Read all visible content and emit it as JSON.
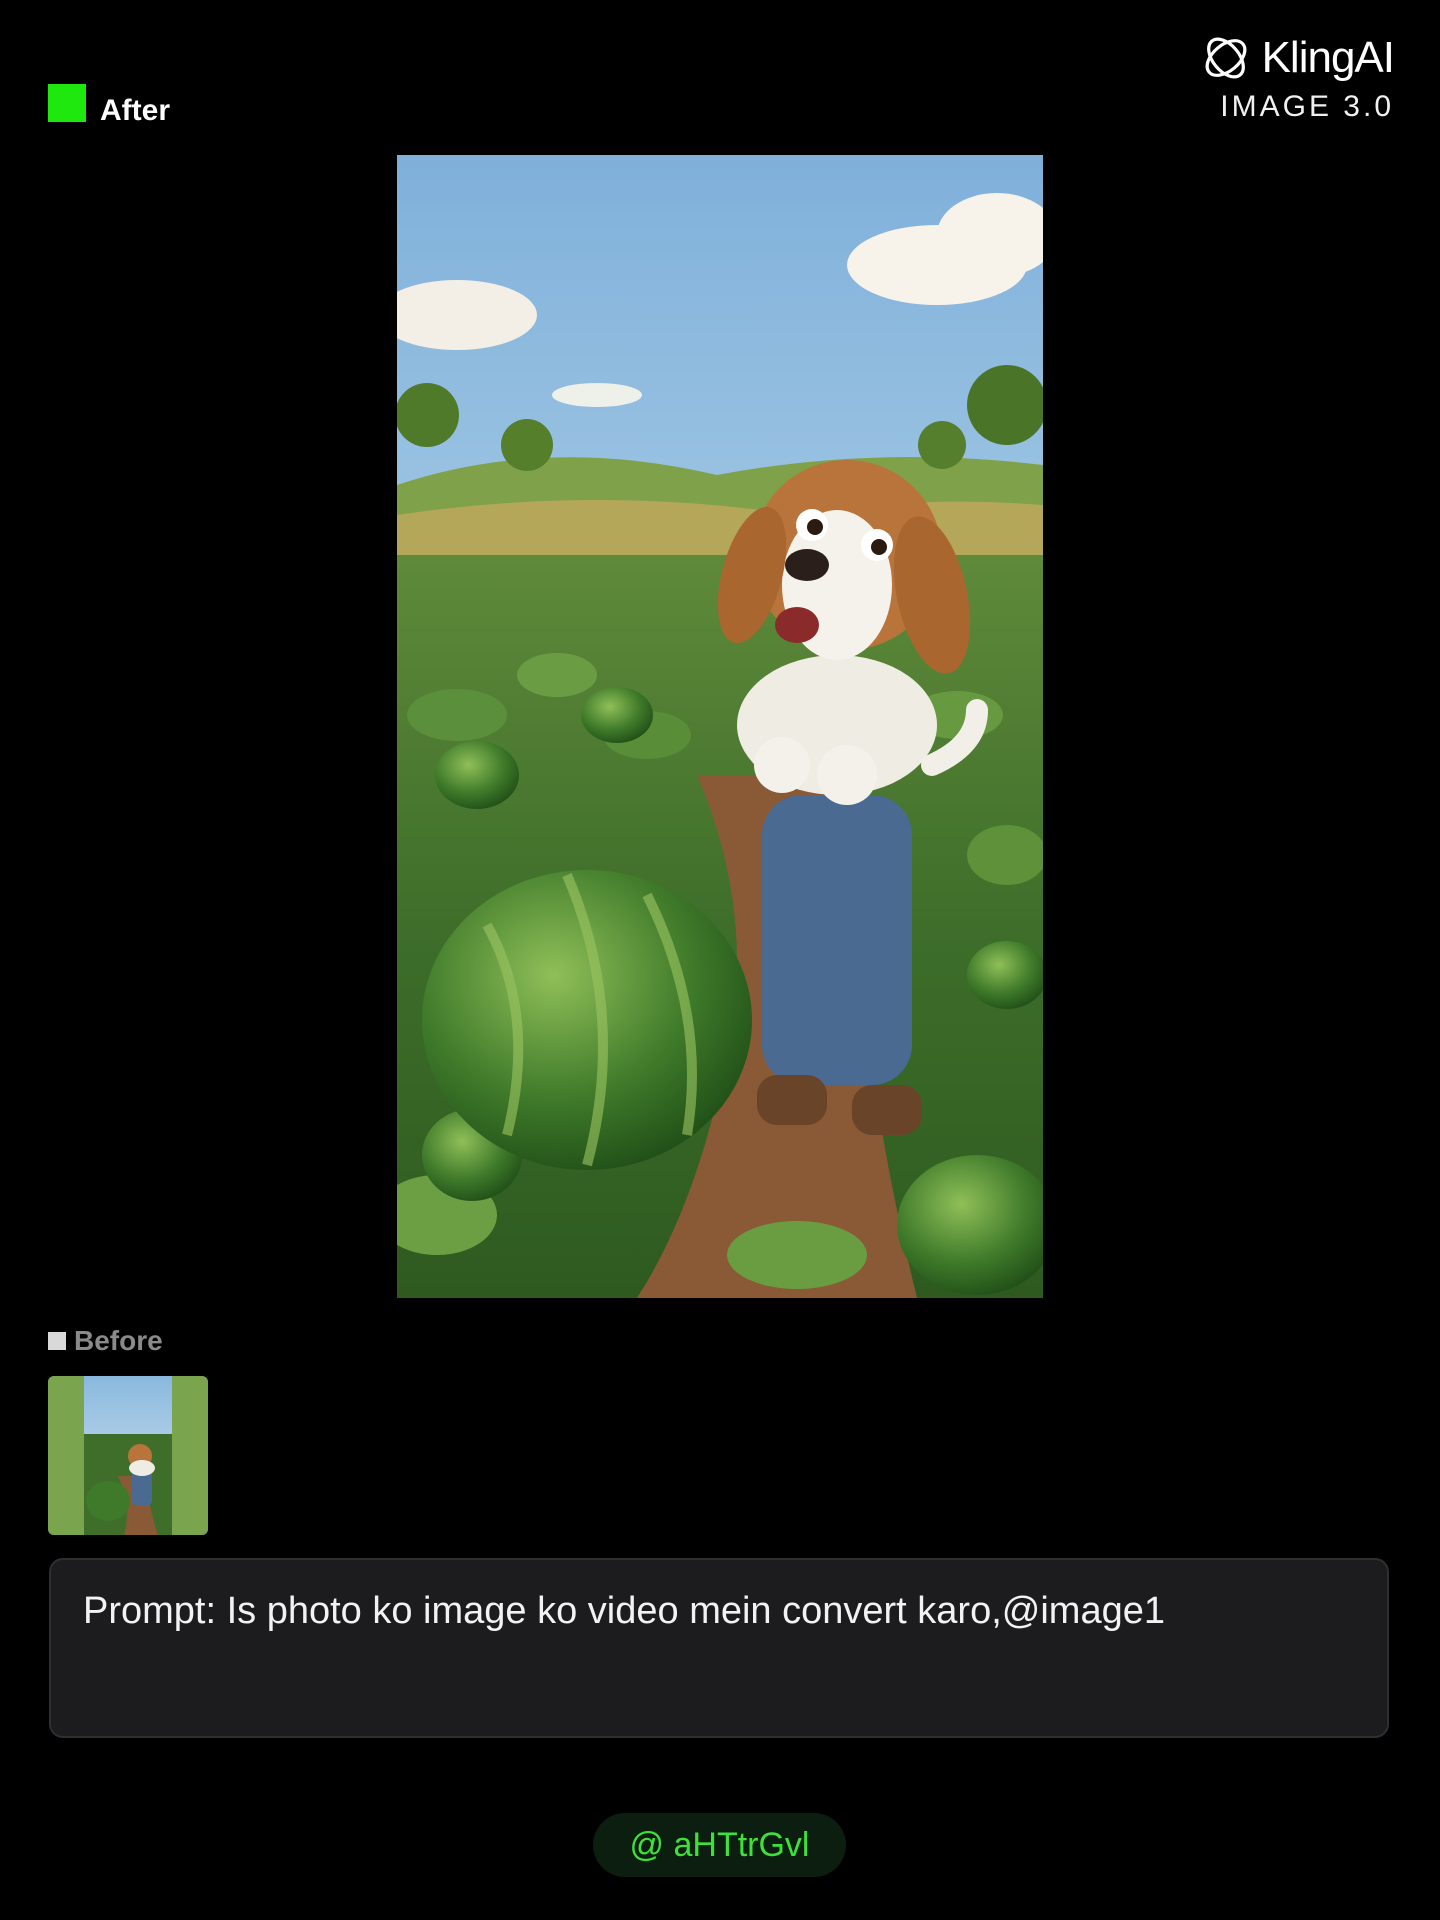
{
  "labels": {
    "after": "After",
    "before": "Before"
  },
  "logo": {
    "name": "KlingAI",
    "subtitle": "IMAGE 3.0"
  },
  "prompt": {
    "text": "Prompt: Is photo ko image ko video mein convert karo,@image1"
  },
  "handle": {
    "text": "@ aHTtrGvl"
  },
  "colors": {
    "background": "#000000",
    "after_marker": "#1ee80e",
    "handle_text": "#3ee03a",
    "prompt_box": "#1c1c1e"
  },
  "icons": {
    "logo": "klingai-logo-icon",
    "after_marker": "green-square-icon",
    "before_marker": "gray-square-icon"
  }
}
